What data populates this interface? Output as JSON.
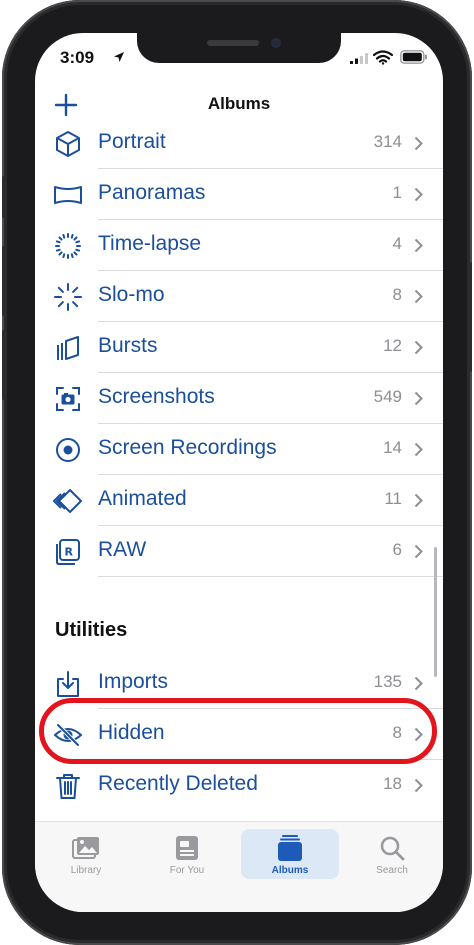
{
  "status_bar": {
    "time": "3:09"
  },
  "nav": {
    "title": "Albums"
  },
  "media_types": [
    {
      "label": "Portrait",
      "count": "314",
      "icon": "cube-icon"
    },
    {
      "label": "Panoramas",
      "count": "1",
      "icon": "panorama-icon"
    },
    {
      "label": "Time-lapse",
      "count": "4",
      "icon": "timelapse-icon"
    },
    {
      "label": "Slo-mo",
      "count": "8",
      "icon": "slomo-icon"
    },
    {
      "label": "Bursts",
      "count": "12",
      "icon": "bursts-icon"
    },
    {
      "label": "Screenshots",
      "count": "549",
      "icon": "screenshot-icon"
    },
    {
      "label": "Screen Recordings",
      "count": "14",
      "icon": "record-icon"
    },
    {
      "label": "Animated",
      "count": "11",
      "icon": "animated-icon"
    },
    {
      "label": "RAW",
      "count": "6",
      "icon": "raw-icon"
    }
  ],
  "utilities": {
    "title": "Utilities",
    "items": [
      {
        "label": "Imports",
        "count": "135",
        "icon": "import-icon"
      },
      {
        "label": "Hidden",
        "count": "8",
        "icon": "eye-slash-icon"
      },
      {
        "label": "Recently Deleted",
        "count": "18",
        "icon": "trash-icon"
      }
    ]
  },
  "tabs": [
    {
      "label": "Library",
      "icon": "photos-icon",
      "active": false
    },
    {
      "label": "For You",
      "icon": "for-you-icon",
      "active": false
    },
    {
      "label": "Albums",
      "icon": "albums-icon",
      "active": true
    },
    {
      "label": "Search",
      "icon": "search-icon",
      "active": false
    }
  ],
  "colors": {
    "accent": "#1b4f9c",
    "highlight": "#e3141b",
    "secondary": "#8e8e93"
  }
}
